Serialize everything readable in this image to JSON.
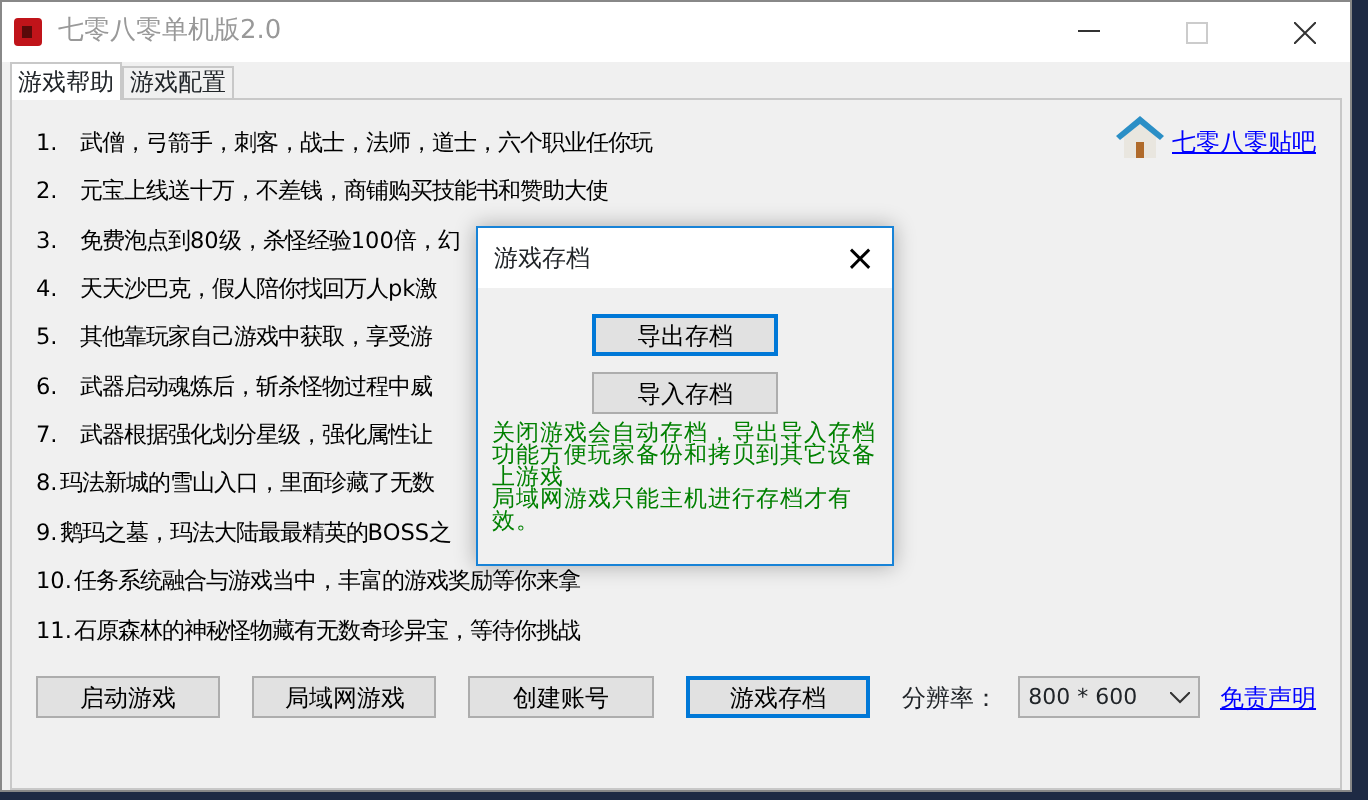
{
  "window": {
    "title": "七零八零单机版2.0"
  },
  "tabs": [
    {
      "label": "游戏帮助",
      "selected": true
    },
    {
      "label": "游戏配置",
      "selected": false
    }
  ],
  "help_link": "七零八零贴吧",
  "help_items": [
    {
      "number": "1.",
      "text": "武僧，弓箭手，刺客，战士，法师，道士，六个职业任你玩"
    },
    {
      "number": "2.",
      "text": "元宝上线送十万，不差钱，商铺购买技能书和赞助大使"
    },
    {
      "number": "3.",
      "text": "免费泡点到80级，杀怪经验100倍，幻"
    },
    {
      "number": "4.",
      "text": "天天沙巴克，假人陪你找回万人pk激"
    },
    {
      "number": "5.",
      "text": "其他靠玩家自己游戏中获取，享受游"
    },
    {
      "number": "6.",
      "text": "武器启动魂炼后，斩杀怪物过程中威"
    },
    {
      "number": "7.",
      "text": "武器根据强化划分星级，强化属性让"
    },
    {
      "number": "8.",
      "text": "玛法新城的雪山入口，里面珍藏了无数"
    },
    {
      "number": "9.",
      "text": "鹅玛之墓，玛法大陆最最精英的BOSS之"
    },
    {
      "number": "10.",
      "text": "任务系统融合与游戏当中，丰富的游戏奖励等你来拿"
    },
    {
      "number": "11.",
      "text": "石原森林的神秘怪物藏有无数奇珍异宝，等待你挑战"
    }
  ],
  "buttons": [
    {
      "label": "启动游戏",
      "focused": false
    },
    {
      "label": "局域网游戏",
      "focused": false
    },
    {
      "label": "创建账号",
      "focused": false
    },
    {
      "label": "游戏存档",
      "focused": true
    }
  ],
  "resolution": {
    "label": "分辨率：",
    "value": "800 * 600"
  },
  "disclaimer_link": "免责声明",
  "dialog": {
    "title": "游戏存档",
    "close": "×",
    "buttons": [
      {
        "label": "导出存档",
        "focused": true
      },
      {
        "label": "导入存档",
        "focused": false
      }
    ],
    "notes": [
      "关闭游戏会自动存档，导出导入存档功能方便玩家备份和拷贝到其它设备上游戏",
      "局域网游戏只能主机进行存档才有效。"
    ]
  }
}
